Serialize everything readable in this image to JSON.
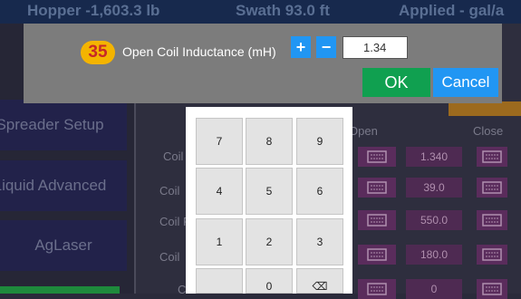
{
  "topbar": {
    "hopper": "Hopper -1,603.3 lb",
    "swath": "Swath 93.0 ft",
    "applied": "Applied - gal/a"
  },
  "sidebar": {
    "items": [
      {
        "label": "Spreader Setup"
      },
      {
        "label": "Liquid Advanced"
      },
      {
        "label": "AgLaser"
      }
    ]
  },
  "table": {
    "open_header": "Open",
    "close_header": "Close",
    "rows": [
      {
        "label": "Coil",
        "value": "1.340"
      },
      {
        "label": "Coil",
        "value": "39.0"
      },
      {
        "label": "Coil R",
        "value": "550.0"
      },
      {
        "label": "Coil",
        "value": "180.0"
      },
      {
        "label": "C",
        "value": "0"
      }
    ]
  },
  "dialog": {
    "number": "35",
    "label": "Open Coil Inductance (mH)",
    "plus": "+",
    "minus": "−",
    "value": "1.34",
    "ok": "OK",
    "cancel": "Cancel"
  },
  "keypad": {
    "keys": [
      "7",
      "8",
      "9",
      "4",
      "5",
      "6",
      "1",
      "2",
      "3",
      "",
      "0",
      "⌫"
    ]
  },
  "colors": {
    "accent_blue": "#2196f3",
    "ok_green": "#10a050",
    "badge_yellow": "#f4b400",
    "badge_text_red": "#c62828"
  }
}
